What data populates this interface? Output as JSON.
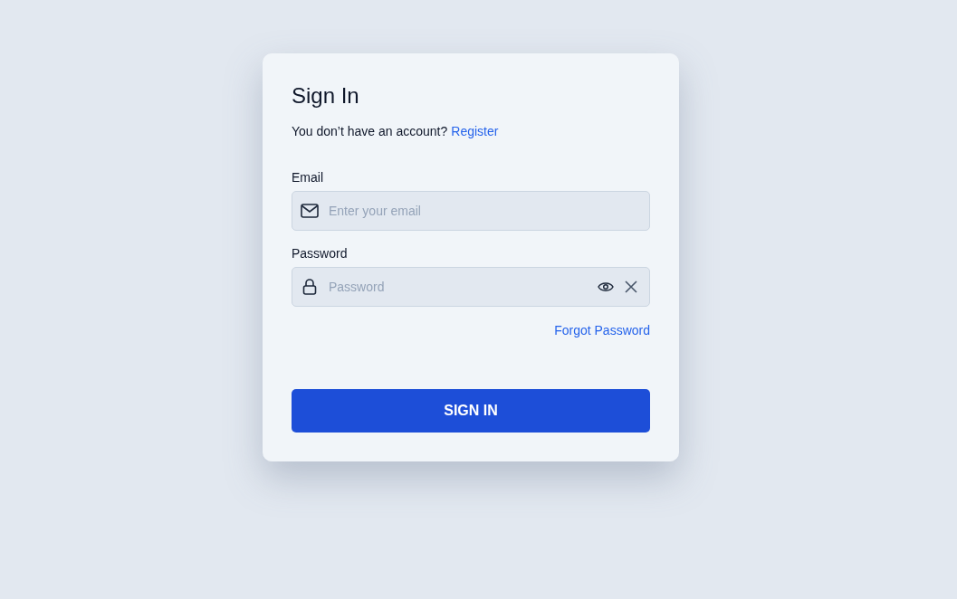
{
  "title": "Sign In",
  "register_prompt": {
    "text": "You don’t have an account?",
    "link": "Register"
  },
  "fields": [
    {
      "kind": "email",
      "label": "Email",
      "placeholder": "Enter your email"
    },
    {
      "kind": "password",
      "label": "Password",
      "placeholder": "Password"
    }
  ],
  "forgot_link": "Forgot Password",
  "submit_button": "SIGN IN"
}
